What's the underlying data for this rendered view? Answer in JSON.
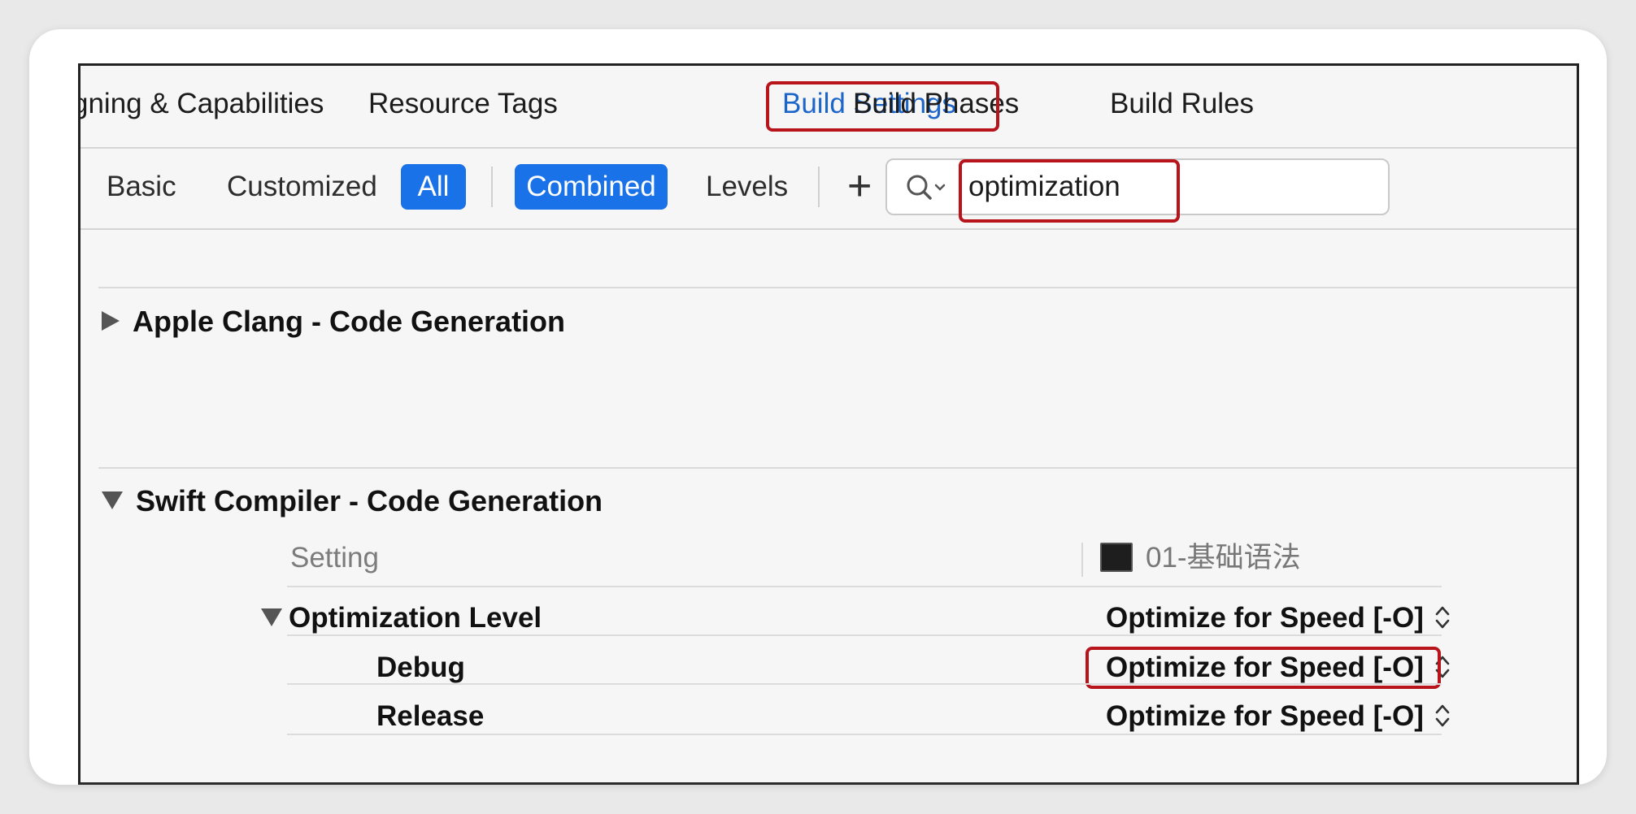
{
  "tabs": [
    {
      "label": "gning & Capabilities",
      "active": false
    },
    {
      "label": "Resource Tags",
      "active": false
    },
    {
      "label": "Build Settings",
      "active": true
    },
    {
      "label": "Build Phases",
      "active": false
    },
    {
      "label": "Build Rules",
      "active": false
    }
  ],
  "filter": {
    "basic": "Basic",
    "customized": "Customized",
    "all": "All",
    "combined": "Combined",
    "levels": "Levels",
    "add": "+"
  },
  "search": {
    "query": "optimization",
    "icon": "magnifier-with-dropdown"
  },
  "sections": [
    {
      "title": "Apple Clang - Code Generation",
      "expanded": false
    },
    {
      "title": "Swift Compiler - Code Generation",
      "expanded": true
    }
  ],
  "table": {
    "setting_header": "Setting",
    "target_label": "01-基础语法",
    "rows": [
      {
        "name": "Optimization Level",
        "value": "Optimize for Speed [-O]"
      },
      {
        "name": "Debug",
        "value": "Optimize for Speed [-O]"
      },
      {
        "name": "Release",
        "value": "Optimize for Speed [-O]"
      }
    ]
  },
  "colors": {
    "accent": "#1a72e8",
    "active_tab_text": "#1d66c9",
    "highlight_outline": "#b8141c",
    "background": "#f6f6f6"
  }
}
